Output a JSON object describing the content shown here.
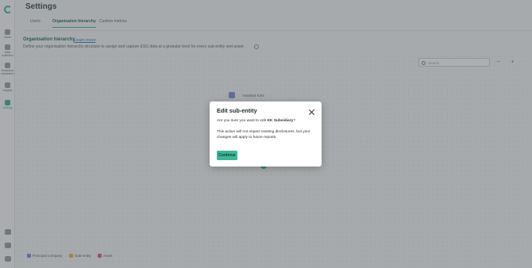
{
  "sidebar": {
    "items": [
      {
        "label": "Home",
        "icon": "home-icon"
      },
      {
        "label": "Data collection",
        "icon": "document-icon"
      },
      {
        "label": "Emissions calculation",
        "icon": "chart-icon"
      },
      {
        "label": "Insights",
        "icon": "bulb-icon"
      },
      {
        "label": "Settings",
        "icon": "gear-icon",
        "active": true
      }
    ],
    "bottom_icons": [
      "help-icon",
      "messages-icon",
      "logout-icon"
    ]
  },
  "page": {
    "title": "Settings",
    "tabs": [
      "Users",
      "Organisation hierarchy",
      "Custom metrics"
    ],
    "active_tab": "Organisation hierarchy",
    "section_title": "Organisation hierarchy",
    "learn_more": "Learn more",
    "section_description": "Define your organisation hierarchy structure to assign and capture ESG data at a granular level for every sub-entity and asset."
  },
  "canvas": {
    "search_placeholder": "Search",
    "zoom_in": "+",
    "zoom_out": "−",
    "node_label": "Assisted Ents",
    "legend": [
      {
        "label": "Principal company",
        "color": "#7e8fd8"
      },
      {
        "label": "Sub-entity",
        "color": "#f0b24a"
      },
      {
        "label": "Asset",
        "color": "#e85a8a"
      }
    ]
  },
  "modal": {
    "title": "Edit sub-entity",
    "question_prefix": "Are you sure you want to edit ",
    "entity_name": "KK Subsidiary",
    "question_suffix": "?",
    "note": "This action will not impact existing disclosures, but your changes will apply to future reports.",
    "continue_label": "Continue"
  },
  "colors": {
    "accent": "#3fb69a",
    "link": "#3f84c8",
    "overlay": "rgba(58,62,70,0.42)"
  }
}
